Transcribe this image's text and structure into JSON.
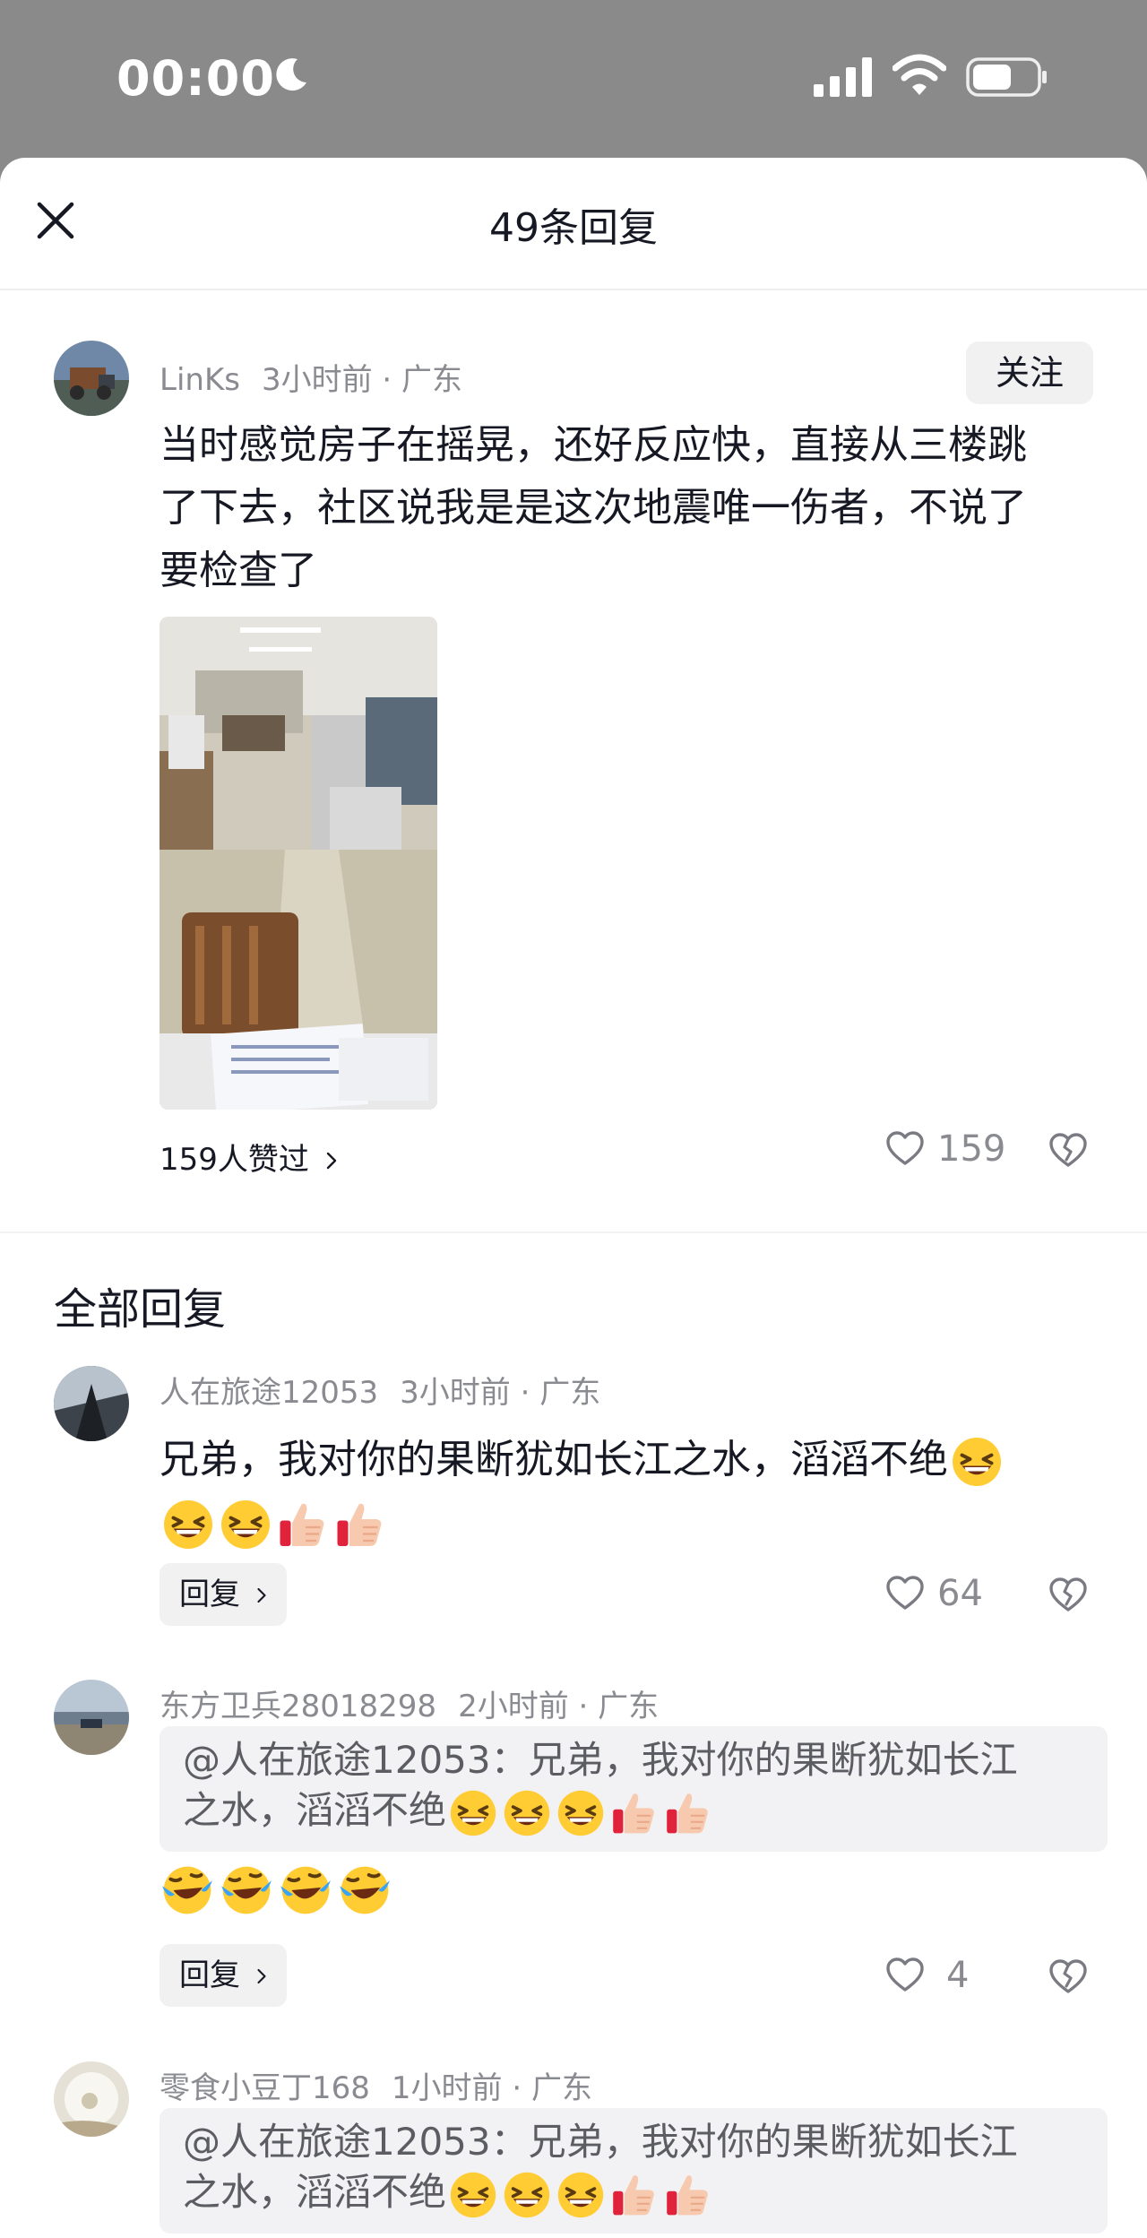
{
  "status_bar": {
    "time": "00:00"
  },
  "header": {
    "title": "49条回复"
  },
  "main_comment": {
    "username": "LinKs",
    "time": "3小时前",
    "location": "广东",
    "follow_label": "关注",
    "line1": "当时感觉房子在摇晃，还好反应快，直接从三楼跳",
    "line2": "了下去，社区说我是是这次地震唯一伤者，不说了",
    "line3": "要检查了",
    "likers_text": "159人赞过",
    "likes": "159"
  },
  "section_title": "全部回复",
  "replies": [
    {
      "username": "人在旅途12053",
      "time": "3小时前",
      "location": "广东",
      "text": "兄弟，我对你的果断犹如长江之水，滔滔不绝",
      "reply_label": "回复",
      "likes": "64"
    },
    {
      "username": "东方卫兵28018298",
      "time": "2小时前",
      "location": "广东",
      "quote_line1": "@人在旅途12053：兄弟，我对你的果断犹如长江",
      "quote_line2": "之水，滔滔不绝",
      "reply_label": "回复",
      "likes": "4"
    },
    {
      "username": "零食小豆丁168",
      "time": "1小时前",
      "location": "广东",
      "quote_line1": "@人在旅途12053：兄弟，我对你的果断犹如长江",
      "quote_line2": "之水，滔滔不绝"
    }
  ],
  "icons": {
    "moon": "moon-icon",
    "signal": "cellular-signal-icon",
    "wifi": "wifi-icon",
    "battery": "battery-icon",
    "close": "close-icon",
    "heart": "heart-icon",
    "dislike": "broken-heart-icon",
    "chevron": "chevron-right-icon",
    "emoji_grin": "grinning-squint-emoji",
    "emoji_thumb": "thumbs-up-emoji",
    "emoji_cry": "rolling-laughing-emoji"
  },
  "colors": {
    "text": "#161823",
    "muted": "#8a8b91",
    "chip": "#f1f1f2",
    "quote_bg": "#f2f2f4",
    "status_bg": "#8a8a8a"
  }
}
